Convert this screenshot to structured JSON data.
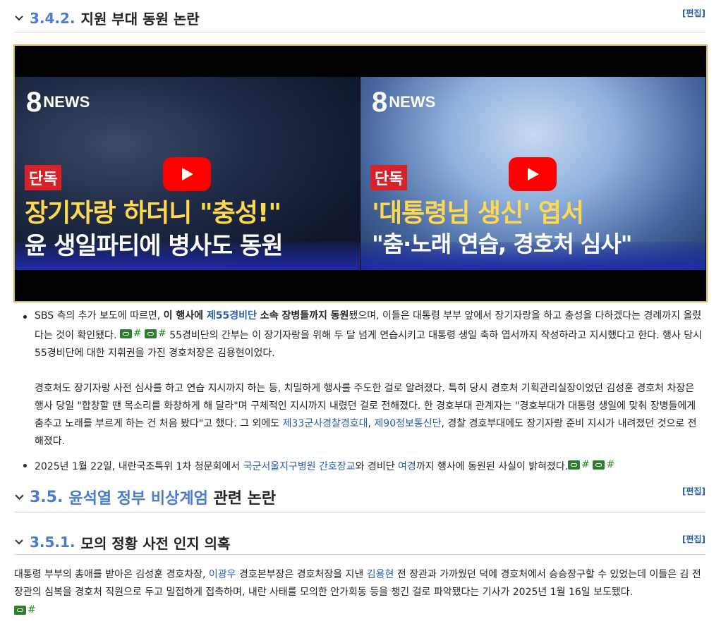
{
  "section1": {
    "number": "3.4.2.",
    "title": "지원 부대 동원 논란",
    "edit": "[편집]"
  },
  "video": {
    "left": {
      "logo": "NEWS",
      "tag": "단독",
      "line1": "장기자랑 하더니 \"충성!\"",
      "line2": "윤 생일파티에 병사도 동원"
    },
    "right": {
      "logo": "NEWS",
      "tag": "단독",
      "line1": "'대통령님 생신' 엽서",
      "line2": "\"춤·노래 연습, 경호처 심사\""
    }
  },
  "bullet1": {
    "t1": "SBS 측의 추가 보도에 따르면, ",
    "b1": "이 행사에 ",
    "link1": "제55경비단",
    "b2": " 소속 장병들까지 동원",
    "t2": "됐으며, 이들은 대통령 부부 앞에서 장기자랑을 하고 충성을 다하겠다는 경례까지 올렸다는 것이 확인됐다. ",
    "ref1": "#",
    "ref2": "#",
    "t3": " 55경비단의 간부는 이 장기자랑을 위해 두 달 넘게 연습시키고 대통령 생일 축하 엽서까지 작성하라고 지시했다고 한다. 행사 당시 55경비단에 대한 지휘권을 가진 경호처장은 김용현이었다.",
    "t4": "경호처도 장기자랑 사전 심사를 하고 연습 지시까지 하는 등, 치밀하게 행사를 주도한 걸로 알려졌다. 특히 당시 경호처 기획관리실장이었던 김성훈 경호처 차장은 행사 당일 \"합창할 땐 목소리를 화창하게 해 달라\"며 구체적인 지시까지 내렸던 걸로 전해졌다. 한 경호부대 관계자는 \"경호부대가 대통령 생일에 맞춰 장병들에게 춤추고 노래를 부르게 하는 건 처음 봤다\"고 했다. 그 외에도 ",
    "link2": "제33군사경찰경호대",
    "t5": ", ",
    "link3": "제90정보통신단",
    "t6": ", 경찰 경호부대에도 장기자랑 준비 지시가 내려졌던 것으로 전해졌다."
  },
  "bullet2": {
    "t1": "2025년 1월 22일, 내란국조특위 1차 청문회에서 ",
    "link1": "국군서울지구병원 간호장교",
    "t2": "와 경비단 ",
    "link2": "여경",
    "t3": "까지 행사에 동원된 사실이 밝혀졌다.",
    "ref1": "#",
    "ref2": "#"
  },
  "section2": {
    "number": "3.5.",
    "title_link": "윤석열 정부 비상계엄",
    "title_rest": " 관련 논란",
    "edit": "[편집]"
  },
  "section3": {
    "number": "3.5.1.",
    "title": "모의 정황 사전 인지 의혹",
    "edit": "[편집]"
  },
  "para": {
    "t1": "대통령 부부의 총애를 받아온 김성훈 경호차장, ",
    "link1": "이광우",
    "t2": " 경호본부장은 경호처장을 지낸 ",
    "link2": "김용현",
    "t3": " 전 장관과 가까웠던 덕에 경호처에서 승승장구할 수 있었는데 이들은 김 전 장관의 심복을 경호처 직원으로 두고 밀접하게 접촉하며, 내란 사태를 모의한 안가회동 등을 챙긴 걸로 파악됐다는 기사가 2025년 1월 16일 보도됐다.",
    "ref1": "#"
  }
}
